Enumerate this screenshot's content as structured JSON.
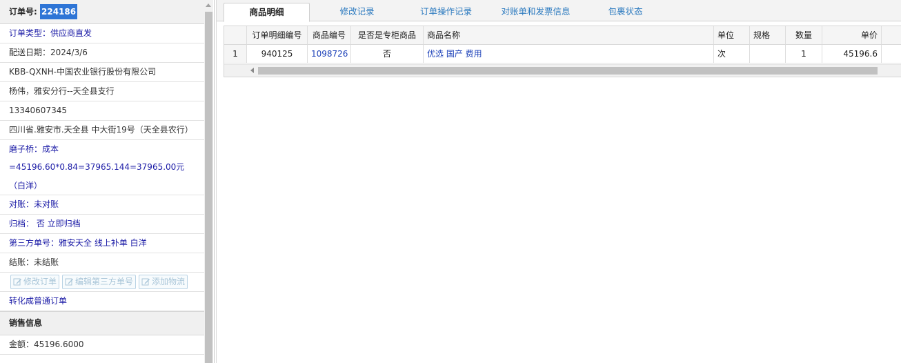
{
  "order": {
    "label": "订单号:",
    "number": "224186"
  },
  "info_rows": [
    "订单类型：供应商直发",
    "配送日期：2024/3/6",
    "KBB-QXNH-中国农业银行股份有限公司",
    "杨伟，雅安分行--天全县支行",
    "13340607345",
    "四川省.雅安市.天全县 中大街19号（天全县农行）"
  ],
  "info_rows_2": [
    "磨子桥：成本=45196.60*0.84=37965.144=37965.00元（白洋）",
    "对账：未对账",
    "归档： 否 立即归档",
    "第三方单号：雅安天全 线上补单 白洋",
    "结账：未结账"
  ],
  "action_buttons": [
    "修改订单",
    "编辑第三方单号",
    "添加物流"
  ],
  "convert_link": "转化成普通订单",
  "sales_section": {
    "title": "销售信息",
    "amount": "金额：45196.6000"
  },
  "tabs": [
    "商品明细",
    "修改记录",
    "订单操作记录",
    "对账单和发票信息",
    "包裹状态"
  ],
  "active_tab": "商品明细",
  "grid": {
    "columns": [
      "",
      "订单明细编号",
      "商品编号",
      "是否是专柜商品",
      "商品名称",
      "单位",
      "规格",
      "数量",
      "单价"
    ],
    "rows": [
      {
        "rownum": "1",
        "detail_no": "940125",
        "product_code": "1098726",
        "is_counter": "否",
        "name": "优选 国产 费用",
        "unit": "次",
        "spec": "",
        "qty": "1",
        "price": "45196.6"
      }
    ]
  },
  "colors": {
    "accent": "#2e75d6",
    "link_blue": "#1a1aa6",
    "tab_text": "#2a79bf"
  }
}
